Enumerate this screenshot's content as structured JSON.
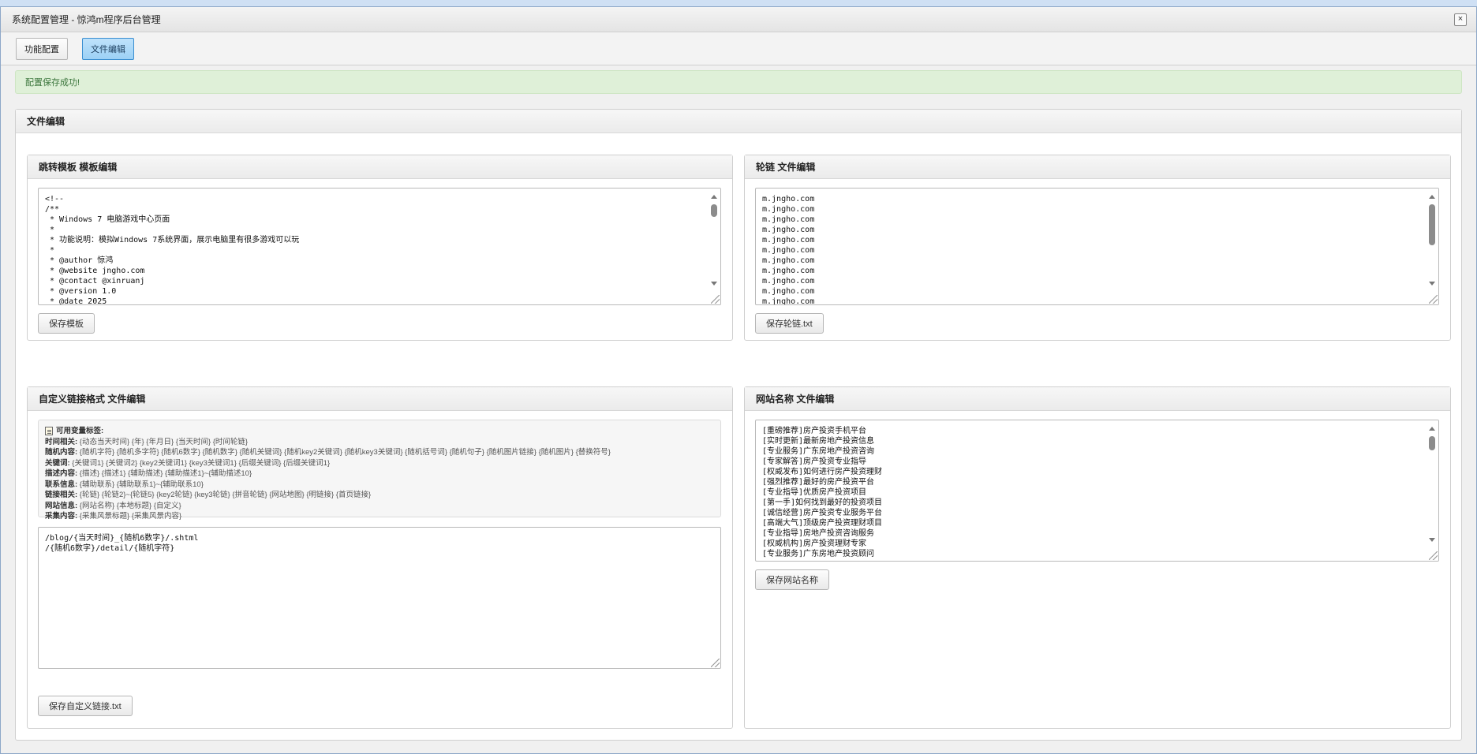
{
  "window": {
    "title": "系统配置管理 - 惊鸿m程序后台管理",
    "close_label": "×"
  },
  "tabs": [
    {
      "label": "功能配置"
    },
    {
      "label": "文件编辑"
    }
  ],
  "alert": {
    "message": "配置保存成功!"
  },
  "section": {
    "title": "文件编辑"
  },
  "panels": {
    "template": {
      "title": "跳转模板 模板编辑",
      "lines": [
        "<!--",
        "/**",
        " * Windows 7 电脑游戏中心页面",
        " *",
        " * 功能说明：模拟Windows 7系统界面，展示电脑里有很多游戏可以玩",
        " *",
        " * @author 惊鸿",
        " * @website jngho.com",
        " * @contact @xinruanj",
        " * @version 1.0",
        " * @date 2025",
        " */",
        "-->"
      ],
      "button": "保存模板"
    },
    "carousel": {
      "title": "轮链 文件编辑",
      "lines": [
        "m.jngho.com",
        "m.jngho.com",
        "m.jngho.com",
        "m.jngho.com",
        "m.jngho.com",
        "m.jngho.com",
        "m.jngho.com",
        "m.jngho.com",
        "m.jngho.com",
        "m.jngho.com",
        "m.jngho.com",
        "m.jngho.com",
        "m.jngho.com"
      ],
      "button": "保存轮链.txt"
    },
    "custom": {
      "title": "自定义链接格式 文件编辑",
      "vars_title": "可用变量标签:",
      "vars": [
        {
          "key": "时间相关:",
          "value": " {动态当天时间} {年} {年月日} {当天时间} {时间轮链}"
        },
        {
          "key": "随机内容:",
          "value": " {随机字符} {随机多字符} {随机6数字} {随机数字} {随机关键词} {随机key2关键词} {随机key3关键词} {随机括号词} {随机句子} {随机图片链接} {随机图片} {替换符号}"
        },
        {
          "key": "关键词:",
          "value": " {关键词1} {关键词2} {key2关键词1} {key3关键词1} {后缀关键词} {后缀关键词1}"
        },
        {
          "key": "描述内容:",
          "value": " {描述} {描述1} {辅助描述} {辅助描述1}~{辅助描述10}"
        },
        {
          "key": "联系信息:",
          "value": " {辅助联系} {辅助联系1}~{辅助联系10}"
        },
        {
          "key": "链接相关:",
          "value": " {轮链} {轮链2}~{轮链5} {key2轮链} {key3轮链} {拼音轮链} {网站地图} {明链接} {首页链接}"
        },
        {
          "key": "网站信息:",
          "value": " {网站名称} {本地标题} {自定义}"
        },
        {
          "key": "采集内容:",
          "value": " {采集风景标题} {采集风景内容}"
        }
      ],
      "lines": [
        "/blog/{当天时间}_{随机6数字}/.shtml",
        "/{随机6数字}/detail/{随机字符}"
      ],
      "button": "保存自定义链接.txt"
    },
    "sitename": {
      "title": "网站名称 文件编辑",
      "lines": [
        "[重磅推荐]房产投资手机平台",
        "[实时更新]最新房地产投资信息",
        "[专业服务]广东房地产投资咨询",
        "[专家解答]房产投资专业指导",
        "[权威发布]如何进行房产投资理财",
        "[强烈推荐]最好的房产投资平台",
        "[专业指导]优质房产投资项目",
        "[第一手]如何找到最好的投资项目",
        "[诚信经营]房产投资专业服务平台",
        "[高端大气]顶级房产投资理财项目",
        "[专业指导]房地产投资咨询服务",
        "[权威机构]房产投资理财专家",
        "[专业服务]广东房地产投资顾问"
      ],
      "button": "保存网站名称"
    }
  }
}
